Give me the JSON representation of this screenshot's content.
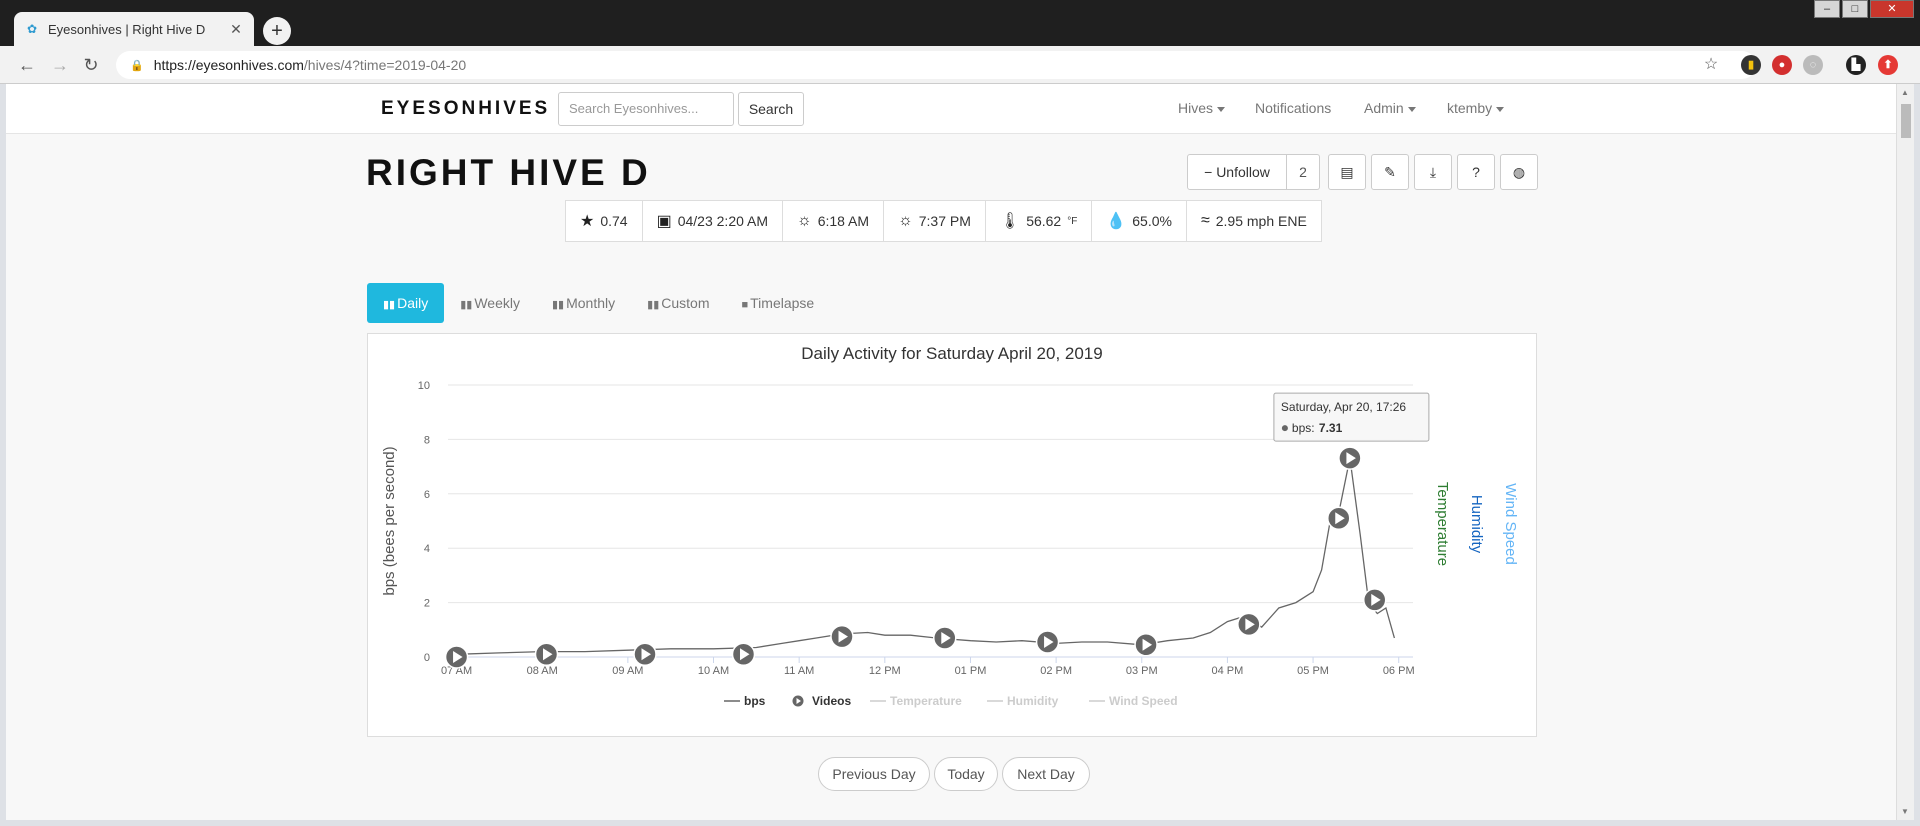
{
  "browser": {
    "tab_title": "Eyesonhives | Right Hive D",
    "url_host": "https://eyesonhives.com",
    "url_path": "/hives/4?time=2019-04-20"
  },
  "navbar": {
    "brand": "EYESONHIVES",
    "search_placeholder": "Search Eyesonhives...",
    "search_button": "Search",
    "links": [
      {
        "label": "Hives",
        "dropdown": true
      },
      {
        "label": "Notifications",
        "dropdown": false
      },
      {
        "label": "Admin",
        "dropdown": true
      },
      {
        "label": "ktemby",
        "dropdown": true
      }
    ]
  },
  "hive": {
    "title": "RIGHT HIVE D",
    "unfollow_label": "Unfollow",
    "follower_count": "2"
  },
  "stats": {
    "rating": "0.74",
    "last_update": "04/23 2:20 AM",
    "sunrise": "6:18 AM",
    "sunset": "7:37 PM",
    "temperature": "56.62",
    "temperature_unit": "°F",
    "humidity": "65.0%",
    "wind": "2.95 mph ENE"
  },
  "period_tabs": [
    {
      "label": "Daily",
      "active": true
    },
    {
      "label": "Weekly",
      "active": false
    },
    {
      "label": "Monthly",
      "active": false
    },
    {
      "label": "Custom",
      "active": false
    },
    {
      "label": "Timelapse",
      "active": false
    }
  ],
  "chart_data": {
    "type": "line",
    "title": "Daily Activity for Saturday April 20, 2019",
    "ylabel": "bps (bees per second)",
    "right_axis_labels": [
      "Temperature",
      "Humidity",
      "Wind Speed"
    ],
    "right_axis_colors": [
      "#2e7d32",
      "#1565c0",
      "#64b5f6"
    ],
    "ylim": [
      0,
      10
    ],
    "yticks": [
      0,
      2,
      4,
      6,
      8,
      10
    ],
    "xlim_hours": [
      6.9,
      18.05
    ],
    "xticks": [
      {
        "h": 7,
        "label": "07 AM"
      },
      {
        "h": 8,
        "label": "08 AM"
      },
      {
        "h": 9,
        "label": "09 AM"
      },
      {
        "h": 10,
        "label": "10 AM"
      },
      {
        "h": 11,
        "label": "11 AM"
      },
      {
        "h": 12,
        "label": "12 PM"
      },
      {
        "h": 13,
        "label": "01 PM"
      },
      {
        "h": 14,
        "label": "02 PM"
      },
      {
        "h": 15,
        "label": "03 PM"
      },
      {
        "h": 16,
        "label": "04 PM"
      },
      {
        "h": 17,
        "label": "05 PM"
      },
      {
        "h": 18,
        "label": "06 PM"
      }
    ],
    "series": [
      {
        "name": "bps",
        "color": "#666666",
        "x": [
          7.0,
          7.5,
          8.0,
          8.5,
          9.0,
          9.5,
          10.0,
          10.5,
          10.8,
          11.0,
          11.2,
          11.5,
          11.8,
          12.0,
          12.3,
          12.6,
          13.0,
          13.3,
          13.6,
          14.0,
          14.3,
          14.6,
          15.0,
          15.3,
          15.6,
          15.8,
          16.0,
          16.2,
          16.4,
          16.6,
          16.8,
          17.0,
          17.1,
          17.2,
          17.3,
          17.43,
          17.55,
          17.65,
          17.75,
          17.85,
          17.95
        ],
        "values": [
          0.1,
          0.15,
          0.2,
          0.2,
          0.25,
          0.3,
          0.3,
          0.35,
          0.5,
          0.6,
          0.7,
          0.85,
          0.9,
          0.8,
          0.8,
          0.7,
          0.6,
          0.55,
          0.6,
          0.5,
          0.55,
          0.55,
          0.45,
          0.6,
          0.7,
          0.9,
          1.3,
          1.5,
          1.1,
          1.8,
          2.0,
          2.4,
          3.2,
          5.0,
          5.3,
          7.31,
          4.5,
          2.0,
          1.6,
          1.8,
          0.7
        ]
      }
    ],
    "videos_hours": [
      7.0,
      8.05,
      9.2,
      10.35,
      11.5,
      12.7,
      13.9,
      15.05,
      16.25,
      17.3,
      17.43,
      17.72
    ],
    "videos_values": [
      0.0,
      0.1,
      0.1,
      0.1,
      0.75,
      0.7,
      0.55,
      0.45,
      1.2,
      5.1,
      7.31,
      2.1
    ],
    "tooltip": {
      "title": "Saturday, Apr 20, 17:26",
      "series": "bps",
      "value": "7.31"
    },
    "legend": [
      {
        "label": "bps",
        "enabled": true
      },
      {
        "label": "Videos",
        "enabled": true
      },
      {
        "label": "Temperature",
        "enabled": false
      },
      {
        "label": "Humidity",
        "enabled": false
      },
      {
        "label": "Wind Speed",
        "enabled": false
      }
    ]
  },
  "day_nav": {
    "previous": "Previous Day",
    "today": "Today",
    "next": "Next Day"
  }
}
